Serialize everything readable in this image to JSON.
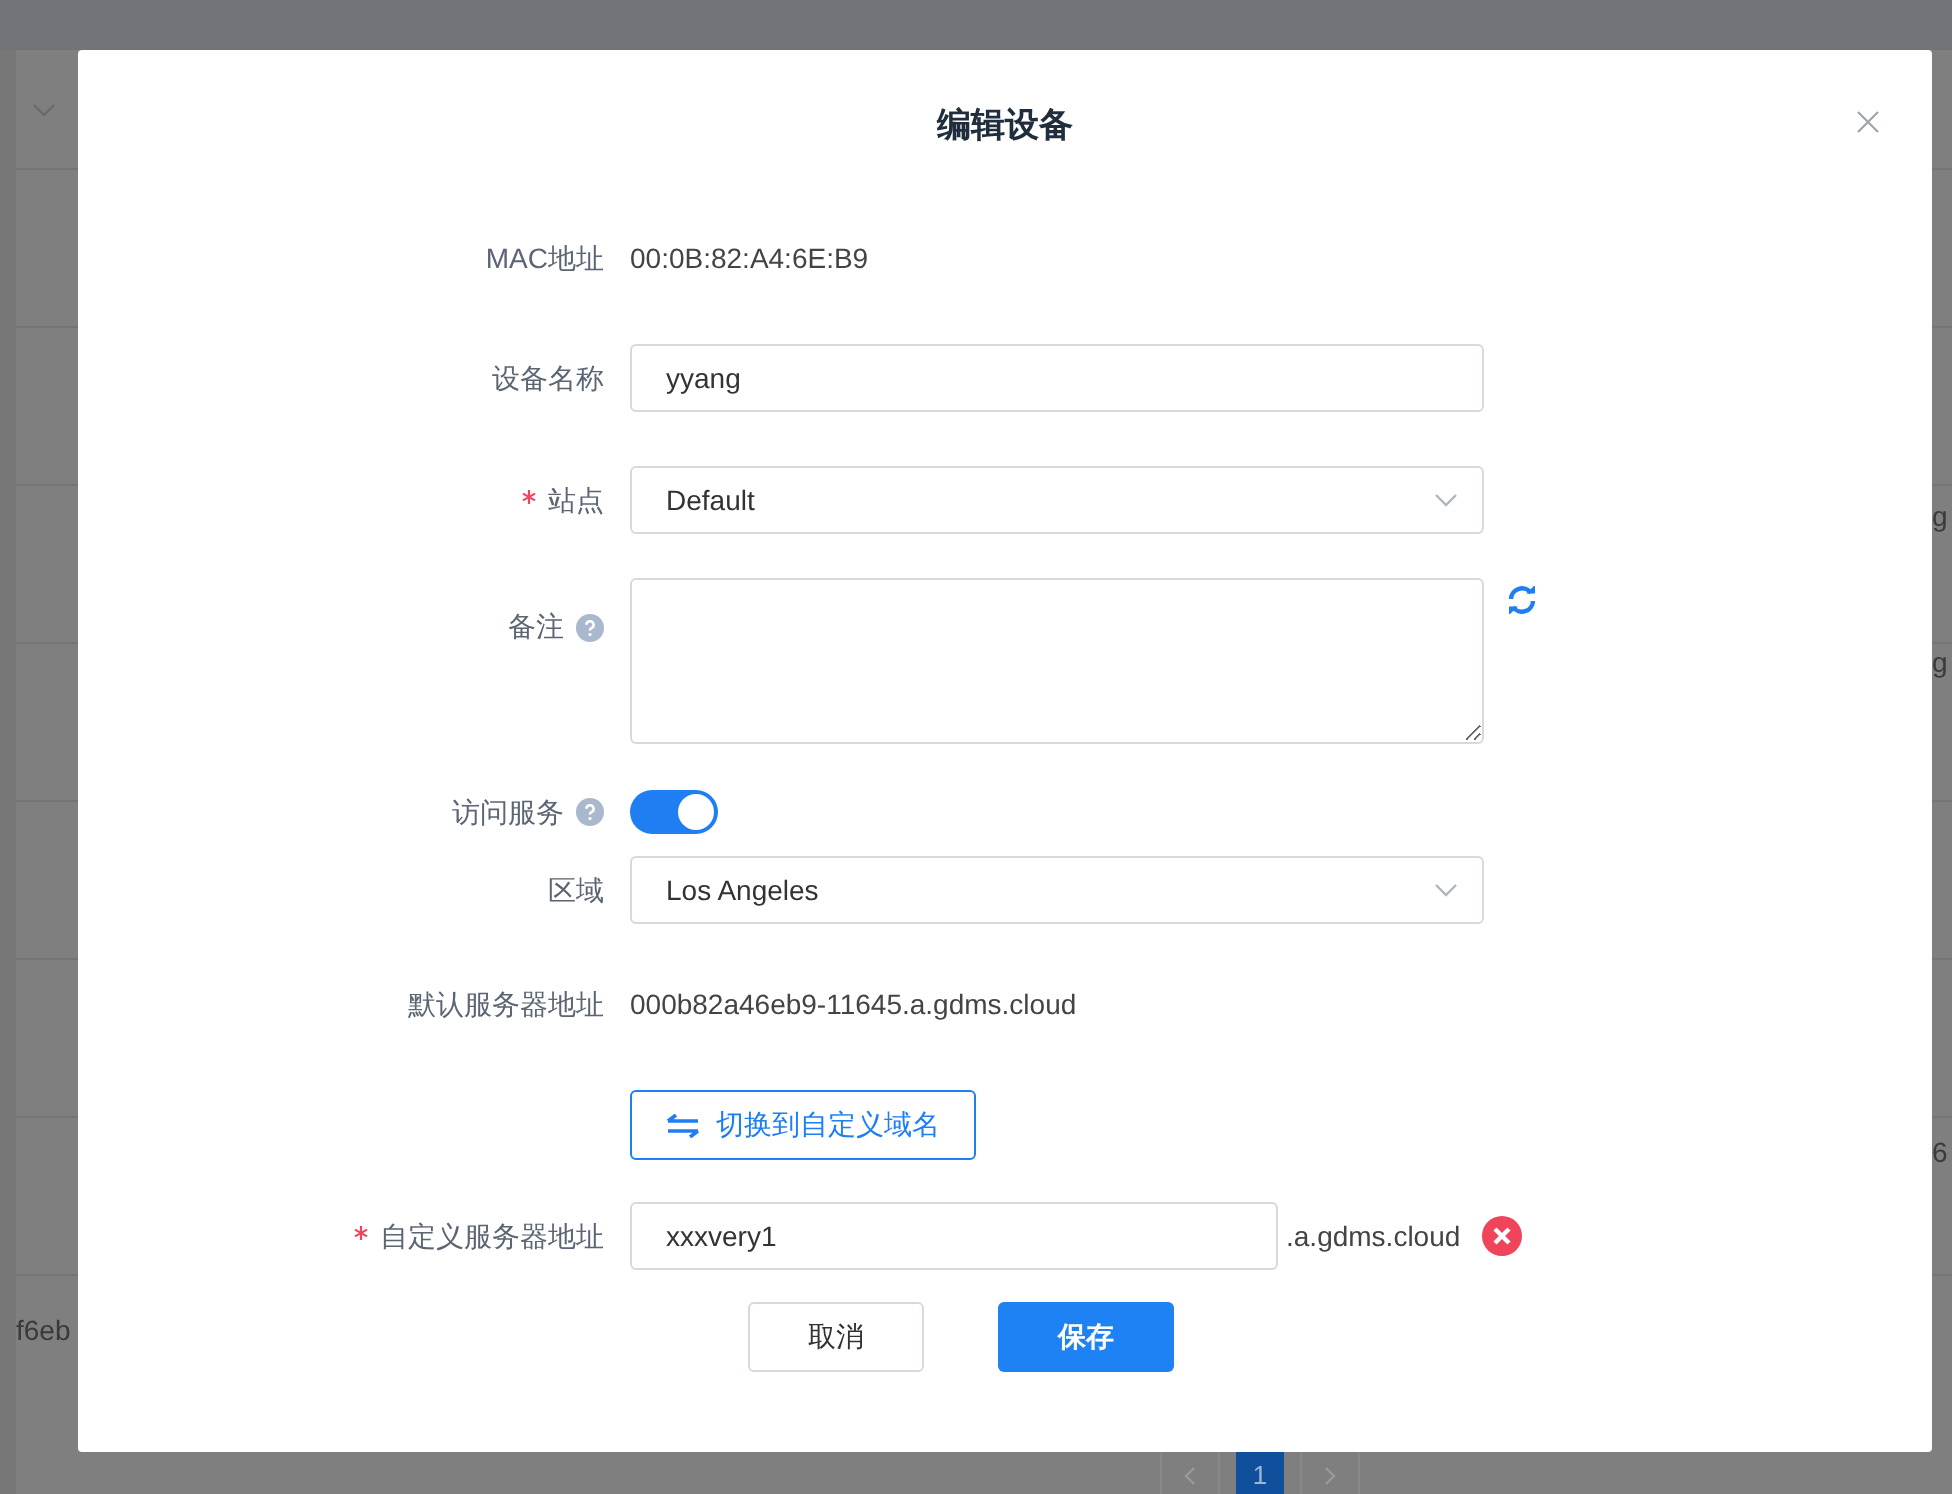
{
  "background": {
    "left_cells": [
      "f6eb"
    ],
    "right_cells": [
      "g",
      "g",
      "6"
    ],
    "pages": [
      {
        "label": "1",
        "selected": true
      }
    ]
  },
  "dialog": {
    "title": "编辑设备",
    "rows": [
      {
        "kind": "static",
        "label": "MAC地址",
        "required": false,
        "help": false,
        "value": "00:0B:82:A4:6E:B9"
      },
      {
        "kind": "text",
        "label": "设备名称",
        "required": false,
        "help": false,
        "value": "yyang"
      },
      {
        "kind": "select",
        "label": "站点",
        "required": true,
        "help": false,
        "value": "Default"
      },
      {
        "kind": "textarea",
        "label": "备注",
        "required": false,
        "help": true,
        "value": ""
      },
      {
        "kind": "switch",
        "label": "访问服务",
        "required": false,
        "help": true,
        "on": true
      },
      {
        "kind": "select",
        "label": "区域",
        "required": false,
        "help": false,
        "value": "Los Angeles"
      },
      {
        "kind": "static",
        "label": "默认服务器地址",
        "required": false,
        "help": false,
        "value": "000b82a46eb9-11645.a.gdms.cloud"
      },
      {
        "kind": "button",
        "value": "切换到自定义域名"
      },
      {
        "kind": "suffix",
        "label": "自定义服务器地址",
        "required": true,
        "help": false,
        "value": "xxxvery1",
        "suffix": ".a.gdms.cloud"
      }
    ],
    "buttons": [
      {
        "label": "取消",
        "primary": false
      },
      {
        "label": "保存",
        "primary": true
      }
    ]
  }
}
